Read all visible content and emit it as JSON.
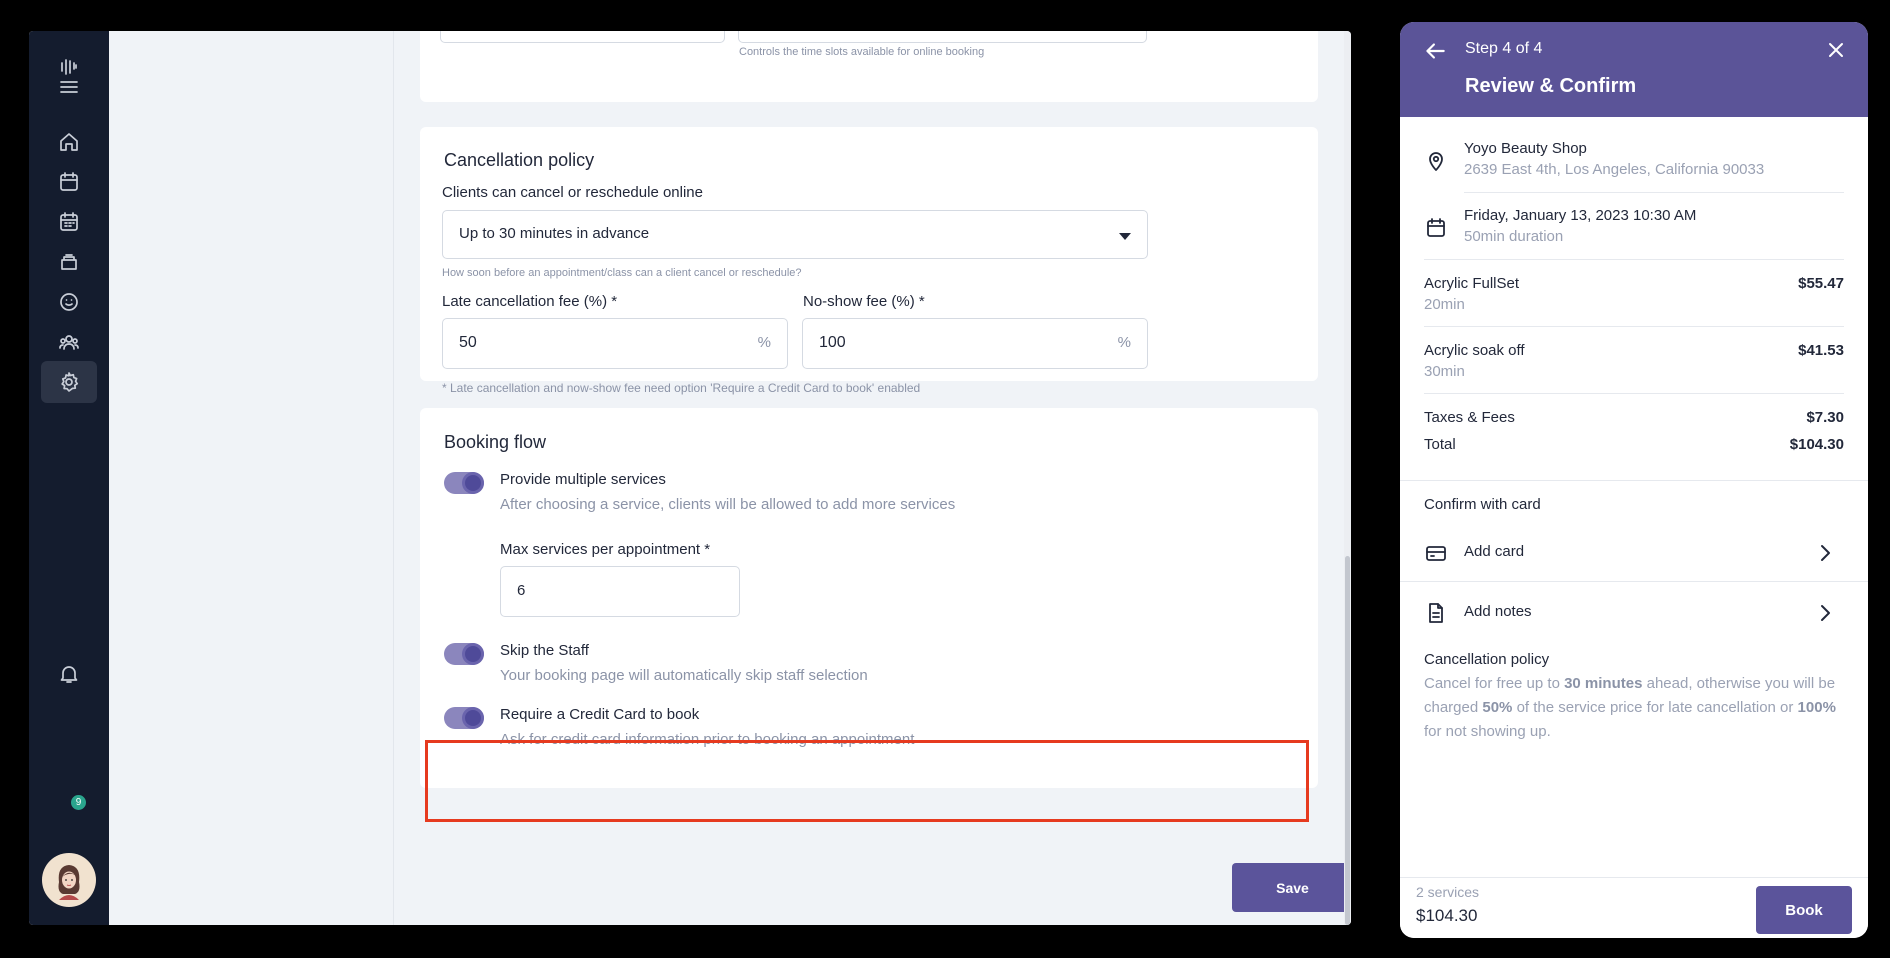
{
  "sidebar": {
    "notification_count": "9"
  },
  "top_fragment": {
    "hint": "Controls the time slots available for online booking"
  },
  "cancellation": {
    "title": "Cancellation policy",
    "select_label": "Clients can cancel or reschedule online",
    "select_value": "Up to 30 minutes in advance",
    "select_hint": "How soon before an appointment/class can a client cancel or reschedule?",
    "late_fee_label": "Late cancellation fee (%) *",
    "late_fee_value": "50",
    "no_show_label": "No-show fee (%) *",
    "no_show_value": "100",
    "percent_suffix": "%",
    "note": "* Late cancellation and now-show fee need option 'Require a Credit Card to book' enabled"
  },
  "booking_flow": {
    "title": "Booking flow",
    "options": [
      {
        "title": "Provide multiple services",
        "desc": "After choosing a service, clients will be allowed to add more services",
        "enabled": true
      },
      {
        "title": "Skip the Staff",
        "desc": "Your booking page will automatically skip staff selection",
        "enabled": true
      },
      {
        "title": "Require a Credit Card to book",
        "desc": "Ask for credit card information prior to booking an appointment",
        "enabled": true
      }
    ],
    "max_services_label": "Max services per appointment *",
    "max_services_value": "6"
  },
  "save_label": "Save",
  "phone": {
    "step": "Step 4 of 4",
    "title": "Review & Confirm",
    "shop_name": "Yoyo Beauty Shop",
    "shop_address": "2639 East 4th, Los Angeles, California 90033",
    "datetime": "Friday, January 13, 2023 10:30 AM",
    "duration": "50min duration",
    "services": [
      {
        "name": "Acrylic FullSet",
        "duration": "20min",
        "price": "$55.47"
      },
      {
        "name": "Acrylic soak off",
        "duration": "30min",
        "price": "$41.53"
      }
    ],
    "taxes_label": "Taxes & Fees",
    "taxes_value": "$7.30",
    "total_label": "Total",
    "total_value": "$104.30",
    "confirm_label": "Confirm with card",
    "add_card": "Add card",
    "add_notes": "Add notes",
    "policy_title": "Cancellation policy",
    "policy_p1": "Cancel for free up to ",
    "policy_b1": "30 minutes",
    "policy_p2": " ahead, otherwise you will be charged ",
    "policy_b2": "50%",
    "policy_p3": " of the service price for late cancellation or ",
    "policy_b3": "100%",
    "policy_p4": " for not showing up.",
    "footer_count": "2 services",
    "footer_total": "$104.30",
    "book_label": "Book"
  },
  "colors": {
    "accent": "#5b549b",
    "sidebar_bg": "#141c2e",
    "highlight": "#e63a1f"
  }
}
